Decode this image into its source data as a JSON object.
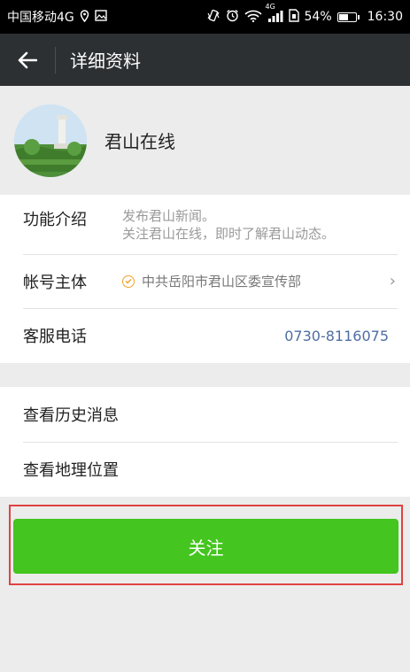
{
  "status_bar": {
    "carrier": "中国移动4G",
    "battery_percent": "54%",
    "battery_level": 0.54,
    "time": "16:30",
    "network": "4G",
    "icons": [
      "location-icon",
      "image-icon",
      "vibrate-icon",
      "alarm-icon",
      "wifi-icon",
      "signal-icon",
      "sim-icon",
      "battery-icon"
    ]
  },
  "header": {
    "back_icon": "back-arrow-icon",
    "title": "详细资料"
  },
  "profile": {
    "name": "君山在线"
  },
  "info": {
    "intro_label": "功能介绍",
    "intro_line1": "发布君山新闻。",
    "intro_line2": "关注君山在线，即时了解君山动态。",
    "owner_label": "帐号主体",
    "owner_value": "中共岳阳市君山区委宣传部",
    "phone_label": "客服电话",
    "phone_value": "0730-8116075"
  },
  "more": {
    "history_label": "查看历史消息",
    "location_label": "查看地理位置"
  },
  "follow_button": {
    "label": "关注"
  },
  "colors": {
    "title_bar": "#2d3033",
    "background": "#ececec",
    "follow_green": "#44c51f",
    "highlight_red": "#e04242",
    "phone_blue": "#4e6ea2",
    "verified_orange": "#f0a32c"
  }
}
